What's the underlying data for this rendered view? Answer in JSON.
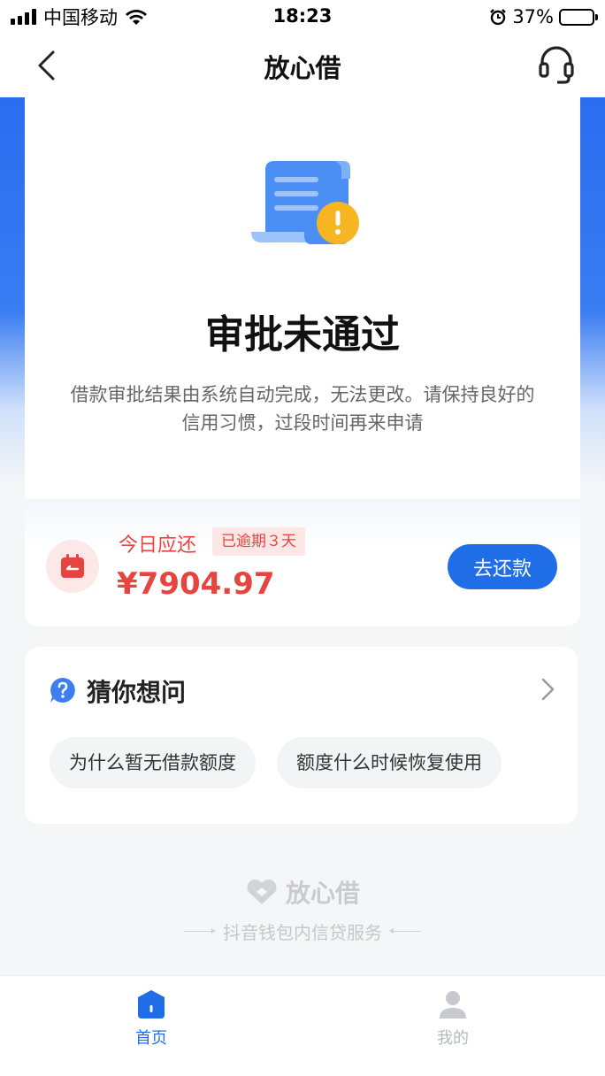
{
  "status_bar": {
    "carrier": "中国移动",
    "time": "18:23",
    "battery": "37%"
  },
  "nav": {
    "title": "放心借"
  },
  "result": {
    "title": "审批未通过",
    "description": "借款审批结果由系统自动完成，无法更改。请保持良好的信用习惯，过段时间再来申请"
  },
  "repayment": {
    "label": "今日应还",
    "badge": "已逾期３天",
    "amount": "¥7904.97",
    "button": "去还款"
  },
  "faq": {
    "title": "猜你想问",
    "chips": [
      "为什么暂无借款额度",
      "额度什么时候恢复使用"
    ]
  },
  "brand": {
    "name": "放心借",
    "tagline": "抖音钱包内信贷服务"
  },
  "tabs": {
    "home": "首页",
    "mine": "我的"
  },
  "colors": {
    "accent": "#1f6ee8",
    "danger": "#e5443f",
    "warning": "#f7b521"
  }
}
